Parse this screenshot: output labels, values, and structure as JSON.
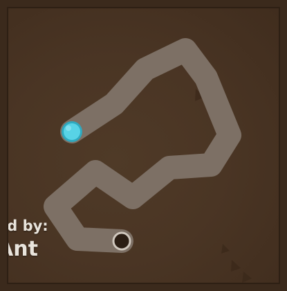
{
  "level": {
    "credit_label": "ed by:",
    "credit_name": "Ant"
  },
  "colors": {
    "background": "#4a3524",
    "path": "#7d7065",
    "player": "#58d3e6",
    "player_ring": "#2fa9bf",
    "hole_fill": "#2b1e14",
    "hole_ring": "#cfc7bd"
  },
  "icons": {
    "player": "cyan-ball-icon",
    "goal": "goal-hole-icon"
  }
}
